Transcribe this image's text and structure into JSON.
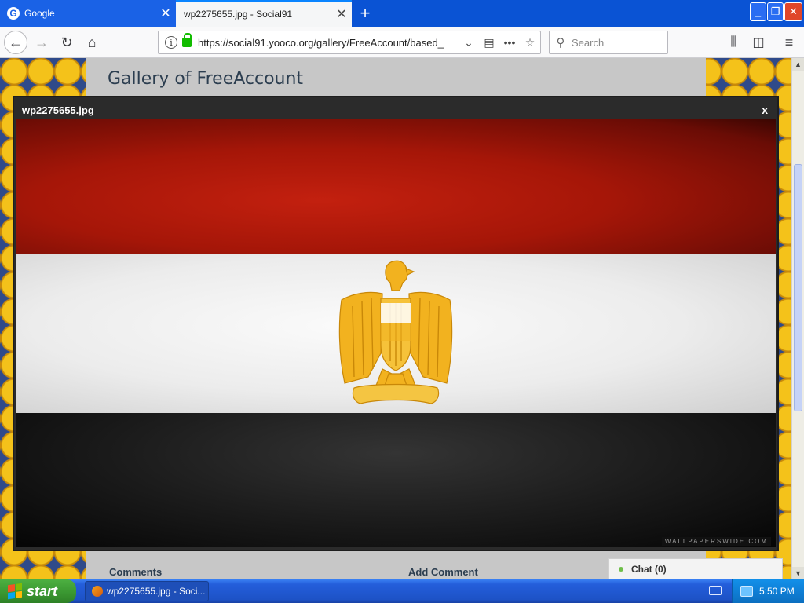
{
  "browser": {
    "tabs": [
      {
        "label": "Google",
        "active": false
      },
      {
        "label": "wp2275655.jpg - Social91",
        "active": true
      }
    ],
    "url": "https://social91.yooco.org/gallery/FreeAccount/based_",
    "search_placeholder": "Search",
    "icons": {
      "info": "i",
      "more": "•••",
      "bookmark": "☆",
      "reader": "▤",
      "new_tab": "+",
      "close_tab": "✕",
      "back": "←",
      "forward": "→",
      "reload": "↻",
      "home": "⌂",
      "search": "⚲",
      "library": "⫼",
      "sidebar": "◫",
      "menu": "≡",
      "dropdown": "⌄"
    }
  },
  "window_buttons": {
    "minimize": "_",
    "maximize": "❐",
    "close": "✕"
  },
  "page": {
    "title": "Gallery of FreeAccount",
    "comments_heading": "Comments",
    "add_comment_heading": "Add Comment",
    "chat_label": "Chat (0)"
  },
  "lightbox": {
    "title": "wp2275655.jpg",
    "close": "x",
    "watermark": "WALLPAPERSWIDE.COM",
    "flag_colors": {
      "red": "#b51a0b",
      "white": "#f2f2f2",
      "black": "#151515",
      "eagle": "#f2b21f"
    }
  },
  "taskbar": {
    "start_label": "start",
    "task_item": "wp2275655.jpg - Soci...",
    "clock": "5:50 PM"
  }
}
